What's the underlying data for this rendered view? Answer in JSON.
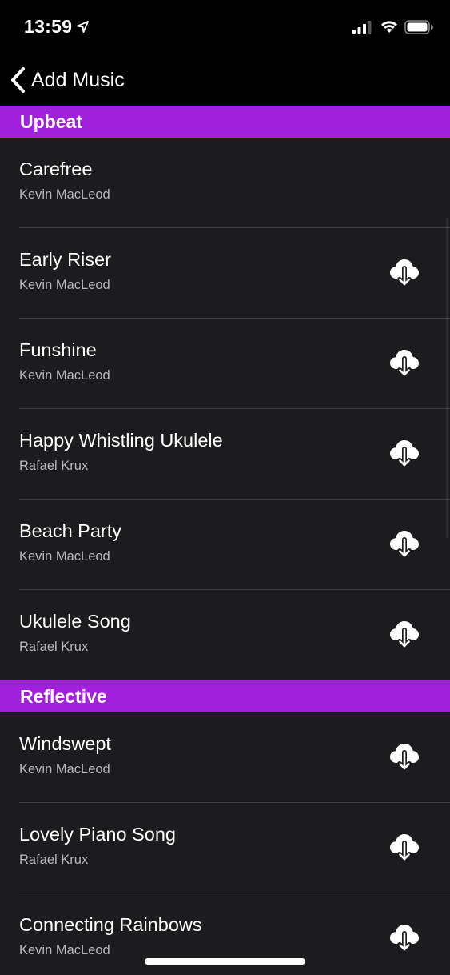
{
  "status_bar": {
    "time": "13:59",
    "icons": [
      "location-arrow-icon",
      "cellular-signal-icon",
      "wifi-icon",
      "battery-icon"
    ]
  },
  "nav": {
    "back_label": "Add Music",
    "back_icon": "chevron-left-icon"
  },
  "colors": {
    "section_header": "#a020dc",
    "background": "#1c1c1e",
    "top_bar": "#000000"
  },
  "sections": [
    {
      "title": "Upbeat",
      "tracks": [
        {
          "title": "Carefree",
          "artist": "Kevin MacLeod",
          "downloadable": false
        },
        {
          "title": "Early Riser",
          "artist": "Kevin MacLeod",
          "downloadable": true
        },
        {
          "title": "Funshine",
          "artist": "Kevin MacLeod",
          "downloadable": true
        },
        {
          "title": "Happy Whistling Ukulele",
          "artist": "Rafael Krux",
          "downloadable": true
        },
        {
          "title": "Beach Party",
          "artist": "Kevin MacLeod",
          "downloadable": true
        },
        {
          "title": "Ukulele Song",
          "artist": "Rafael Krux",
          "downloadable": true
        }
      ]
    },
    {
      "title": "Reflective",
      "tracks": [
        {
          "title": "Windswept",
          "artist": "Kevin MacLeod",
          "downloadable": true
        },
        {
          "title": "Lovely Piano Song",
          "artist": "Rafael Krux",
          "downloadable": true
        },
        {
          "title": "Connecting Rainbows",
          "artist": "Kevin MacLeod",
          "downloadable": true
        }
      ]
    }
  ],
  "download_icon": "cloud-download-icon"
}
